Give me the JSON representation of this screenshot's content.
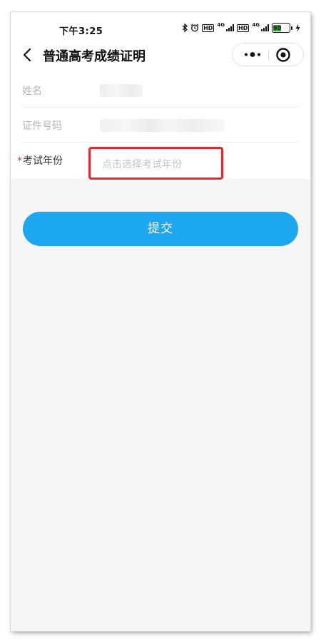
{
  "status_bar": {
    "time": "下午3:25",
    "hd1": "HD",
    "net1": "4G",
    "hd2": "HD",
    "net2": "4G",
    "battery": "90",
    "battery_color": "#1fb52a"
  },
  "nav": {
    "title": "普通高考成绩证明",
    "icons": [
      "chevron-left-icon",
      "more-dots-icon",
      "target-icon"
    ]
  },
  "form": {
    "name_label": "姓名",
    "id_label": "证件号码",
    "year_required_mark": "*",
    "year_label": "考试年份",
    "year_placeholder": "点击选择考试年份"
  },
  "submit_label": "提交",
  "colors": {
    "accent": "#1ba8f1",
    "highlight_border": "#e8262b",
    "required_mark": "#e33c3c"
  }
}
